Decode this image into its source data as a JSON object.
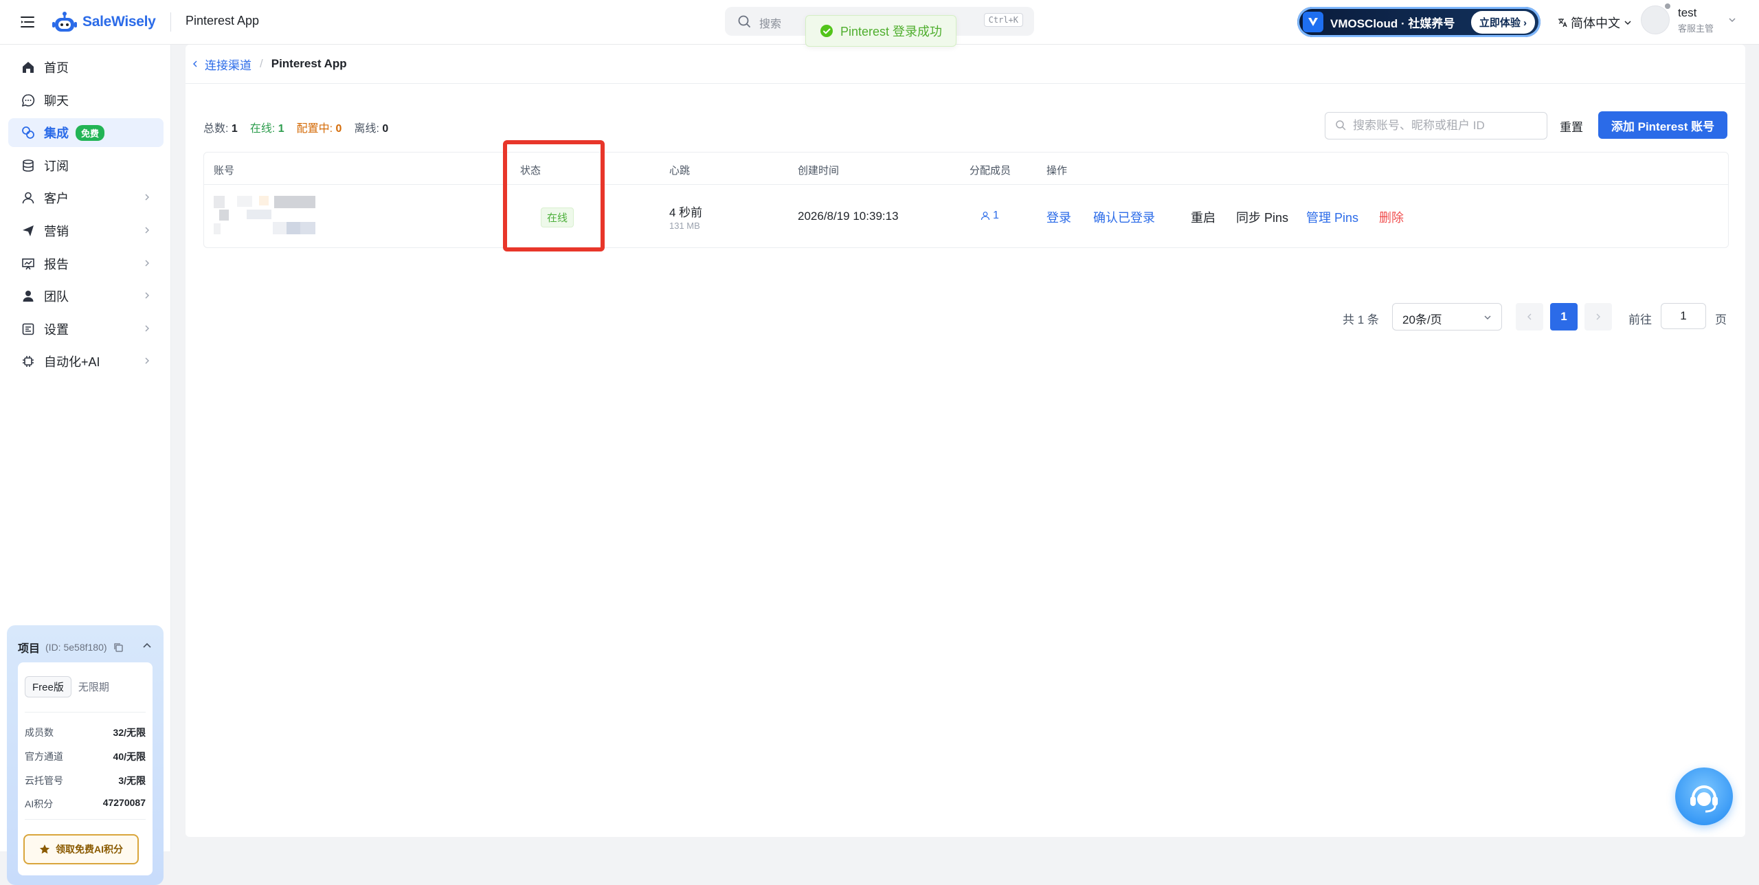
{
  "header": {
    "brand": "SaleWisely",
    "app_title": "Pinterest App",
    "search_placeholder": "搜索",
    "search_shortcut": "Ctrl+K",
    "toast": "Pinterest 登录成功",
    "promo_text": "VMOSCloud · 社媒养号",
    "promo_button": "立即体验",
    "language": "简体中文",
    "user_name": "test",
    "user_role": "客服主管"
  },
  "sidebar": {
    "items": [
      {
        "label": "首页",
        "icon": "home-icon"
      },
      {
        "label": "聊天",
        "icon": "chat-icon"
      },
      {
        "label": "集成",
        "icon": "integration-icon",
        "badge": "免费",
        "active": true
      },
      {
        "label": "订阅",
        "icon": "database-icon"
      },
      {
        "label": "客户",
        "icon": "user-icon",
        "has_children": true
      },
      {
        "label": "营销",
        "icon": "send-icon",
        "has_children": true
      },
      {
        "label": "报告",
        "icon": "report-icon",
        "has_children": true
      },
      {
        "label": "团队",
        "icon": "team-icon",
        "has_children": true
      },
      {
        "label": "设置",
        "icon": "settings-icon",
        "has_children": true
      },
      {
        "label": "自动化+AI",
        "icon": "chip-icon",
        "has_children": true
      }
    ],
    "project": {
      "title": "项目",
      "id": "(ID: 5e58f180)",
      "plan": "Free版",
      "term": "无限期",
      "stats": [
        {
          "label": "成员数",
          "value": "32/无限"
        },
        {
          "label": "官方通道",
          "value": "40/无限"
        },
        {
          "label": "云托管号",
          "value": "3/无限"
        },
        {
          "label": "AI积分",
          "value": "47270087"
        }
      ],
      "ai_button": "领取免费AI积分"
    }
  },
  "breadcrumb": {
    "parent": "连接渠道",
    "separator": "/",
    "current": "Pinterest App"
  },
  "summary": {
    "total_label": "总数:",
    "total": "1",
    "online_label": "在线:",
    "online": "1",
    "config_label": "配置中:",
    "config": "0",
    "offline_label": "离线:",
    "offline": "0"
  },
  "toolbar": {
    "search_placeholder": "搜索账号、昵称或租户 ID",
    "reset": "重置",
    "add": "添加 Pinterest 账号"
  },
  "table": {
    "columns": [
      "账号",
      "状态",
      "心跳",
      "创建时间",
      "分配成员",
      "操作"
    ],
    "rows": [
      {
        "status": "在线",
        "heartbeat": "4 秒前",
        "memory": "131 MB",
        "created": "2026/8/19 10:39:13",
        "members": "1",
        "actions": [
          "登录",
          "确认已登录",
          "重启",
          "同步 Pins",
          "管理 Pins",
          "删除"
        ]
      }
    ]
  },
  "pagination": {
    "total": "共 1 条",
    "page_size": "20条/页",
    "current": "1",
    "goto_label": "前往",
    "goto_value": "1",
    "goto_unit": "页"
  },
  "colors": {
    "accent": "#2b6be8",
    "online": "#4caf3a",
    "danger": "#f04e4e",
    "highlight": "#e8362a"
  }
}
